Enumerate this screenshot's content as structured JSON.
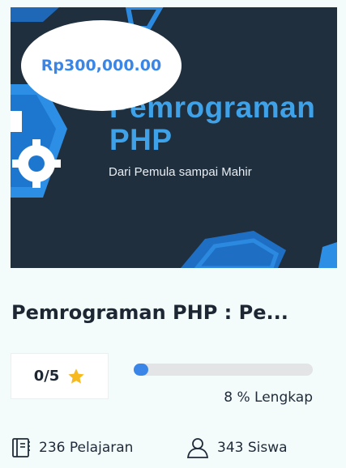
{
  "course": {
    "price": "Rp300,000.00",
    "thumbnail": {
      "title_line1": "Pemrograman",
      "title_line2": "PHP",
      "subtitle": "Dari Pemula sampai Mahir"
    },
    "title": "Pemrograman PHP : Pe...",
    "rating": {
      "label": "0/5",
      "icon": "star-icon",
      "color": "#f6b91e"
    },
    "progress": {
      "percent": 8,
      "label": "8 % Lengkap",
      "color": "#3a86e8"
    },
    "stats": {
      "lessons": {
        "icon": "book-icon",
        "label": "236 Pelajaran"
      },
      "students": {
        "icon": "user-icon",
        "label": "343 Siswa"
      }
    }
  }
}
